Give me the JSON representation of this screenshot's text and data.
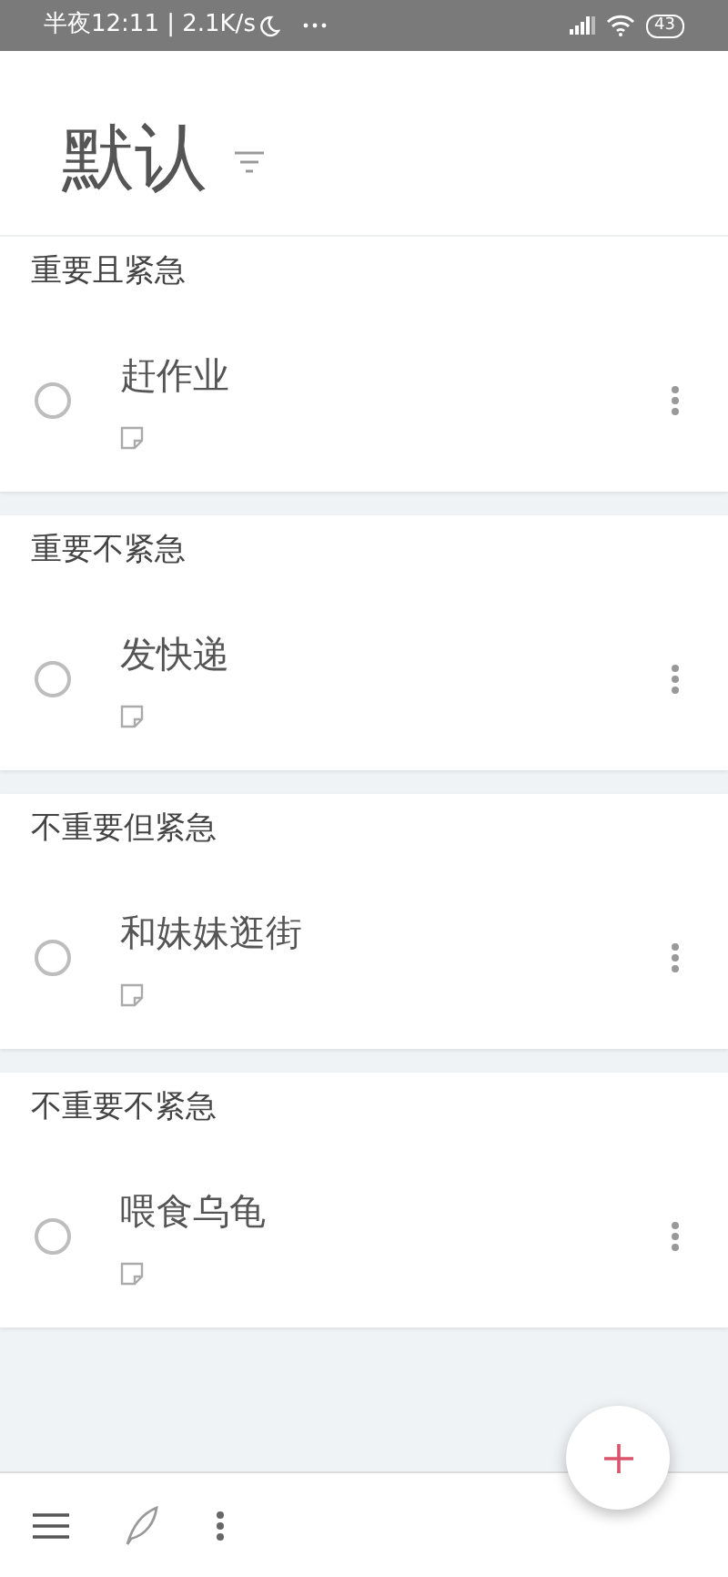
{
  "status_bar": {
    "time": "半夜12:11 | 2.1K/s",
    "battery": "43"
  },
  "header": {
    "title": "默认"
  },
  "sections": [
    {
      "title": "重要且紧急",
      "tasks": [
        {
          "title": "赶作业",
          "checked": false
        }
      ]
    },
    {
      "title": "重要不紧急",
      "tasks": [
        {
          "title": "发快递",
          "checked": false
        }
      ]
    },
    {
      "title": "不重要但紧急",
      "tasks": [
        {
          "title": "和妹妹逛街",
          "checked": false
        }
      ]
    },
    {
      "title": "不重要不紧急",
      "tasks": [
        {
          "title": "喂食乌龟",
          "checked": false
        }
      ]
    }
  ]
}
